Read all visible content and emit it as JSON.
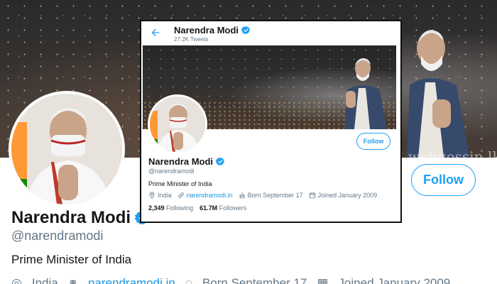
{
  "background": {
    "follow_label": "Follow",
    "name": "Narendra Modi",
    "handle": "@narendramodi",
    "bio": "Prime Minister of India",
    "location": "India",
    "website": "narendramodi.in",
    "born": "Born September 17",
    "joined": "Joined January 2009",
    "watermark": "webgossip.lk"
  },
  "card": {
    "header": {
      "title": "Narendra Modi",
      "tweet_count": "27.2K Tweets"
    },
    "follow_label": "Follow",
    "name": "Narendra Modi",
    "handle": "@narendramodi",
    "bio": "Prime Minister of India",
    "location": "India",
    "website": "narendramodi.in",
    "born": "Born September 17",
    "joined": "Joined January 2009",
    "following_count": "2,349",
    "following_label": "Following",
    "followers_count": "61.7M",
    "followers_label": "Followers"
  },
  "colors": {
    "accent": "#1da1f2",
    "link": "#1b95e0",
    "secondary_text": "#657786",
    "primary_text": "#14171a"
  },
  "icons": [
    "back-arrow-icon",
    "verified-badge-icon",
    "location-icon",
    "link-icon",
    "birthday-icon",
    "calendar-icon"
  ]
}
